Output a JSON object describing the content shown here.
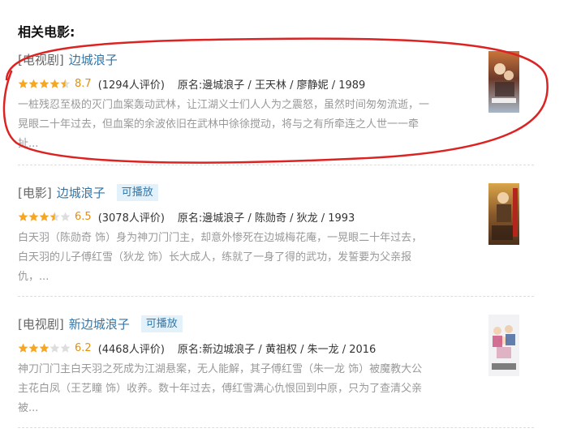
{
  "page": {
    "heading": "相关电影:"
  },
  "colors": {
    "link": "#3377aa",
    "rating": "#e09015",
    "star": "#f5a623",
    "star_empty": "#dddddd",
    "annotation_stroke": "#dd2222",
    "badge_bg": "#e3f1fa",
    "desc_text": "#999999"
  },
  "items": [
    {
      "category": "[电视剧]",
      "title": "边城浪子",
      "playable": "",
      "stars": 4.5,
      "rating": "8.7",
      "votes": "(1294人评价)",
      "subject": "原名:邊城浪子 / 王天林 / 廖静妮 / 1989",
      "desc_lines": [
        "一桩残忍至极的灭门血案轰动武林，让江湖义士们人人为之震怒，虽然时间匆匆流逝，一",
        "晃眼二十年过去，但血案的余波依旧在武林中徐徐搅动，将与之有所牵连之人世一一牵",
        "扯..."
      ]
    },
    {
      "category": "[电影]",
      "title": "边城浪子",
      "playable": "可播放",
      "stars": 3.5,
      "rating": "6.5",
      "votes": "(3078人评价)",
      "subject": "原名:邊城浪子 / 陈勋奇 / 狄龙 / 1993",
      "desc_lines": [
        "白天羽（陈勋奇 饰）身为神刀门门主，却意外惨死在边城梅花庵，一晃眼二十年过去，",
        "白天羽的儿子傅红雪（狄龙 饰）长大成人，练就了一身了得的武功，发誓要为父亲报",
        "仇，..."
      ]
    },
    {
      "category": "[电视剧]",
      "title": "新边城浪子",
      "playable": "可播放",
      "stars": 3,
      "rating": "6.2",
      "votes": "(4468人评价)",
      "subject": "原名:新边城浪子 / 黄祖权 / 朱一龙 / 2016",
      "desc_lines": [
        "神刀门门主白天羽之死成为江湖悬案，无人能解，其子傅红雪（朱一龙 饰）被魔教大公",
        "主花白凤（王艺瞳 饰）收养。数十年过去，傅红雪满心仇恨回到中原，只为了查清父亲",
        "被..."
      ]
    }
  ]
}
